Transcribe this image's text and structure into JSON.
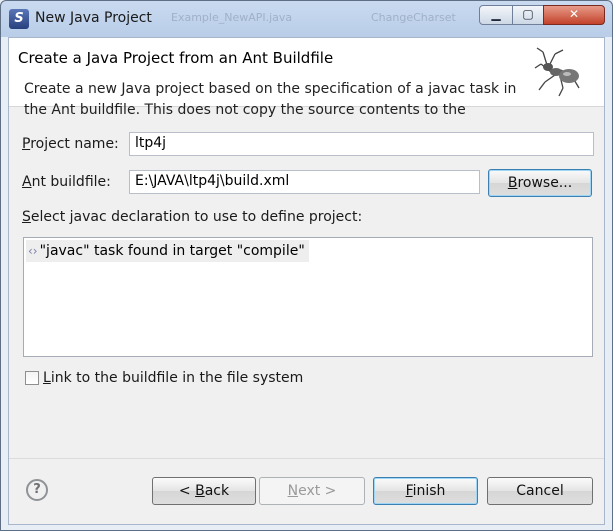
{
  "window": {
    "title": "New Java Project",
    "background_titles": [
      "Example_NewAPI.java",
      "ChangeCharset"
    ],
    "controls": {
      "minimize": "▁",
      "maximize": "▢",
      "close": "✕"
    }
  },
  "header": {
    "title": "Create a Java Project from an Ant Buildfile",
    "description": "Create a new Java project based on the specification of a javac task in the Ant buildfile. This does not copy the source contents to the",
    "image_icon": "ant-icon"
  },
  "form": {
    "project_name_label_mn": "P",
    "project_name_label_rest": "roject name:",
    "project_name_value": "ltp4j",
    "buildfile_label_mn": "A",
    "buildfile_label_rest": "nt buildfile:",
    "buildfile_value": "E:\\JAVA\\ltp4j\\build.xml",
    "browse_mn": "B",
    "browse_rest": "rowse...",
    "select_label_mn": "S",
    "select_label_rest": "elect javac declaration to use to define project:",
    "javac_items": [
      {
        "icon": "‹›",
        "label": "\"javac\" task found in target \"compile\""
      }
    ],
    "link_label_mn": "L",
    "link_label_rest": "ink to the buildfile in the file system",
    "link_checked": false
  },
  "footer": {
    "help_icon": "?",
    "back_prefix": "< ",
    "back_mn": "B",
    "back_rest": "ack",
    "next_mn": "N",
    "next_rest": "ext >",
    "finish_mn": "F",
    "finish_rest": "inish",
    "cancel": "Cancel"
  }
}
